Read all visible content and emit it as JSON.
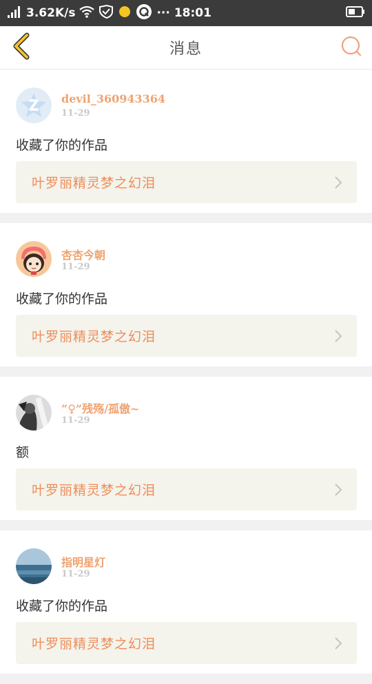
{
  "status_bar": {
    "network_speed": "3.62K/s",
    "time": "18:01",
    "more": "···"
  },
  "header": {
    "title": "消息"
  },
  "messages": [
    {
      "username": "devil_360943364",
      "date": "11-29",
      "text": "收藏了你的作品",
      "work_title": "叶罗丽精灵梦之幻泪",
      "avatar": "avatar-default-icon"
    },
    {
      "username": "杏杏今朝",
      "date": "11-29",
      "text": "收藏了你的作品",
      "work_title": "叶罗丽精灵梦之幻泪",
      "avatar": "avatar-cartoon-girl"
    },
    {
      "username": "“♀”残殇/孤傲~",
      "date": "11-29",
      "text": "额",
      "work_title": "叶罗丽精灵梦之幻泪",
      "avatar": "avatar-bw-photo"
    },
    {
      "username": "指明星灯",
      "date": "11-29",
      "text": "收藏了你的作品",
      "work_title": "叶罗丽精灵梦之幻泪",
      "avatar": "avatar-sea-photo"
    }
  ],
  "colors": {
    "accent": "#ef8d58",
    "back_arrow": "#e8b420",
    "link_bg": "#f4f3ec"
  }
}
